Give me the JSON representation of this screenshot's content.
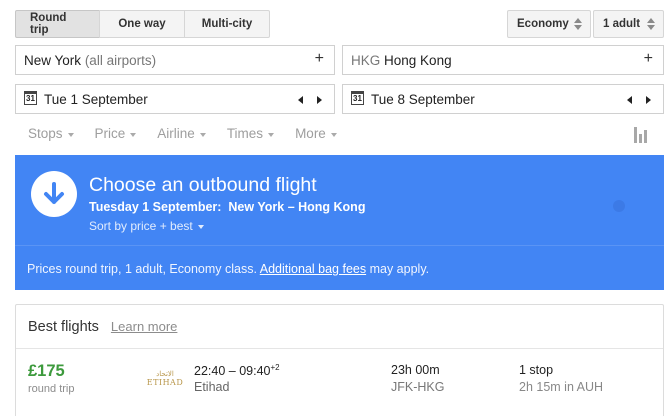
{
  "trip_types": [
    "Round trip",
    "One way",
    "Multi-city"
  ],
  "cabin": {
    "value": "Economy"
  },
  "passengers": {
    "value": "1 adult"
  },
  "origin": {
    "main": "New York",
    "detail": "(all airports)",
    "add": "+"
  },
  "destination": {
    "code": "HKG",
    "name": "Hong Kong",
    "add": "+"
  },
  "depart": {
    "cal_day": "31",
    "value": "Tue 1 September"
  },
  "return": {
    "cal_day": "31",
    "value": "Tue 8 September"
  },
  "filters": [
    "Stops",
    "Price",
    "Airline",
    "Times",
    "More"
  ],
  "banner": {
    "title": "Choose an outbound flight",
    "subtitle_date": "Tuesday 1 September:",
    "subtitle_route": "New York – Hong Kong",
    "sort": "Sort by price + best",
    "note_prefix": "Prices round trip, 1 adult, Economy class.",
    "note_link": "Additional bag fees",
    "note_suffix": "may apply.",
    "color": "#4285f4"
  },
  "results": {
    "heading": "Best flights",
    "learn_more": "Learn more",
    "flights": [
      {
        "price": "£175",
        "price_note": "round trip",
        "airline_logo_text": "ETIHAD",
        "depart_time": "22:40",
        "arrive_time": "09:40",
        "day_offset": "+2",
        "airline": "Etihad",
        "duration": "23h 00m",
        "route": "JFK-HKG",
        "stops": "1 stop",
        "layover": "2h 15m in AUH",
        "price_color": "#3d9a3d"
      }
    ]
  }
}
